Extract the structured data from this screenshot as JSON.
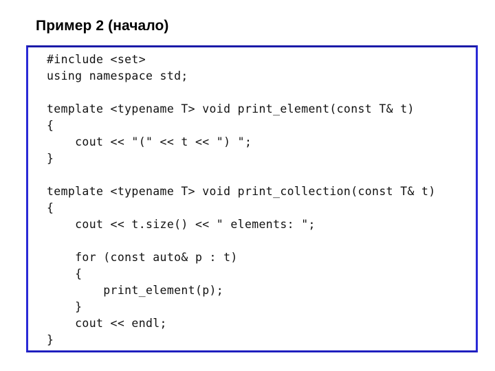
{
  "slide": {
    "title": "Пример 2 (начало)",
    "background_color": "#ffffff",
    "border_color": "#2020cc",
    "text_color": "#000000"
  },
  "code_block": {
    "language": "C++",
    "lines": [
      "#include <set>",
      "using namespace std;",
      "",
      "template <typename T> void print_element(const T& t)",
      "{",
      "    cout << \"(\" << t << \") \";",
      "}",
      "",
      "template <typename T> void print_collection(const T& t)",
      "{",
      "    cout << t.size() << \" elements: \";",
      "",
      "    for (const auto& p : t)",
      "    {",
      "        print_element(p);",
      "    }",
      "    cout << endl;",
      "}"
    ]
  }
}
